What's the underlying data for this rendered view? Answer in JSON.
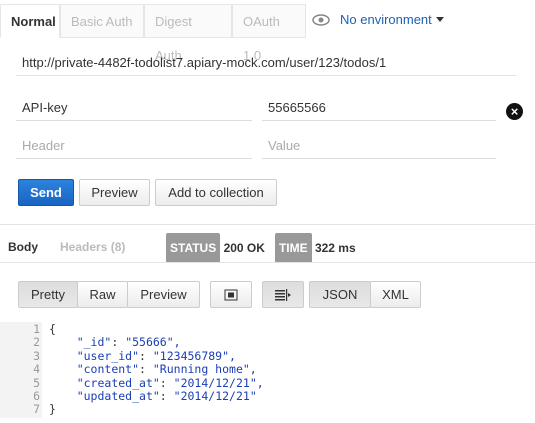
{
  "auth_tabs": [
    "Normal",
    "Basic Auth",
    "Digest Auth",
    "OAuth 1.0"
  ],
  "environment": {
    "label": "No environment",
    "icon": "eye-icon"
  },
  "url": "http://private-4482f-todolist7.apiary-mock.com/user/123/todos/1",
  "headers": [
    {
      "key": "API-key",
      "value": "55665566"
    }
  ],
  "new_header": {
    "key_placeholder": "Header",
    "value_placeholder": "Value"
  },
  "actions": {
    "send": "Send",
    "preview": "Preview",
    "add_to_collection": "Add to collection"
  },
  "response": {
    "tabs": {
      "body": "Body",
      "headers": "Headers (8)"
    },
    "status_label": "STATUS",
    "status_value": "200 OK",
    "time_label": "TIME",
    "time_value": "322 ms"
  },
  "view_modes": {
    "pretty": "Pretty",
    "raw": "Raw",
    "preview": "Preview",
    "json": "JSON",
    "xml": "XML"
  },
  "code_lines": [
    {
      "n": "1",
      "text": "{"
    },
    {
      "n": "2",
      "key": "\"_id\"",
      "value": "\"55666\","
    },
    {
      "n": "3",
      "key": "\"user_id\"",
      "value": "\"123456789\","
    },
    {
      "n": "4",
      "key": "\"content\"",
      "value": "\"Running home\","
    },
    {
      "n": "5",
      "key": "\"created_at\"",
      "value": "\"2014/12/21\","
    },
    {
      "n": "6",
      "key": "\"updated_at\"",
      "value": "\"2014/12/21\""
    },
    {
      "n": "7",
      "text": "}"
    }
  ],
  "colors": {
    "accent": "#1a62b8",
    "send_button": "#1865c4",
    "badge": "#999999"
  }
}
